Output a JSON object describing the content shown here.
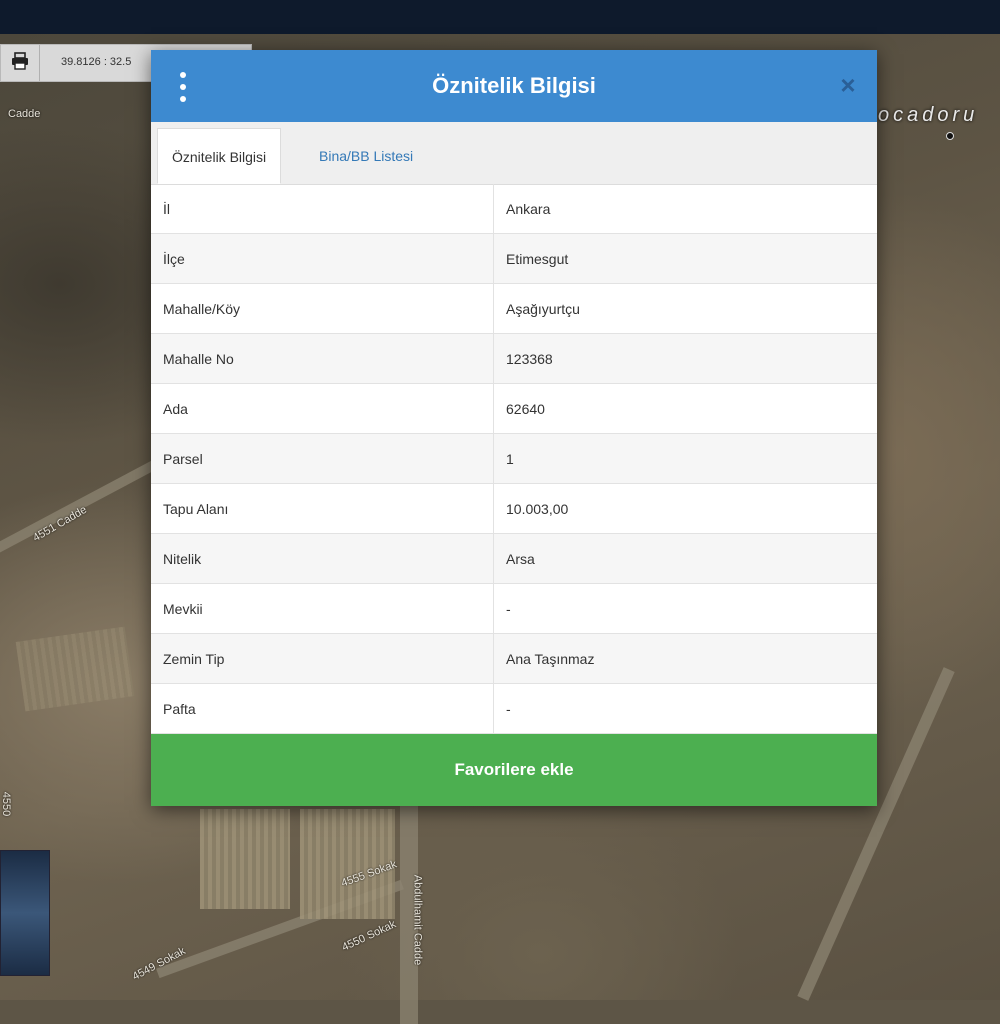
{
  "toolbar": {
    "coordinates": "39.8126 : 32.5"
  },
  "map": {
    "labels": [
      "Cadde",
      "4551 Cadde",
      "4555 Sokak",
      "4550 Sokak",
      "4549 Sokak",
      "Abdulhamit Cadde",
      "4550"
    ],
    "place_name": "ocadoru"
  },
  "modal": {
    "title": "Öznitelik Bilgisi",
    "tabs": [
      {
        "label": "Öznitelik Bilgisi"
      },
      {
        "label": "Bina/BB Listesi"
      }
    ],
    "rows": [
      {
        "key": "İl",
        "value": "Ankara"
      },
      {
        "key": "İlçe",
        "value": "Etimesgut"
      },
      {
        "key": "Mahalle/Köy",
        "value": "Aşağıyurtçu"
      },
      {
        "key": "Mahalle No",
        "value": "123368"
      },
      {
        "key": "Ada",
        "value": "62640"
      },
      {
        "key": "Parsel",
        "value": "1"
      },
      {
        "key": "Tapu Alanı",
        "value": "10.003,00"
      },
      {
        "key": "Nitelik",
        "value": "Arsa"
      },
      {
        "key": "Mevkii",
        "value": "-"
      },
      {
        "key": "Zemin Tip",
        "value": "Ana Taşınmaz"
      },
      {
        "key": "Pafta",
        "value": "-"
      }
    ],
    "close_symbol": "×",
    "favorite_label": "Favorilere ekle"
  },
  "colors": {
    "header": "#3d8ad0",
    "button": "#4caf50",
    "tab_link": "#3479b7"
  },
  "icons": [
    "print-icon",
    "kebab-menu-icon",
    "close-icon"
  ]
}
